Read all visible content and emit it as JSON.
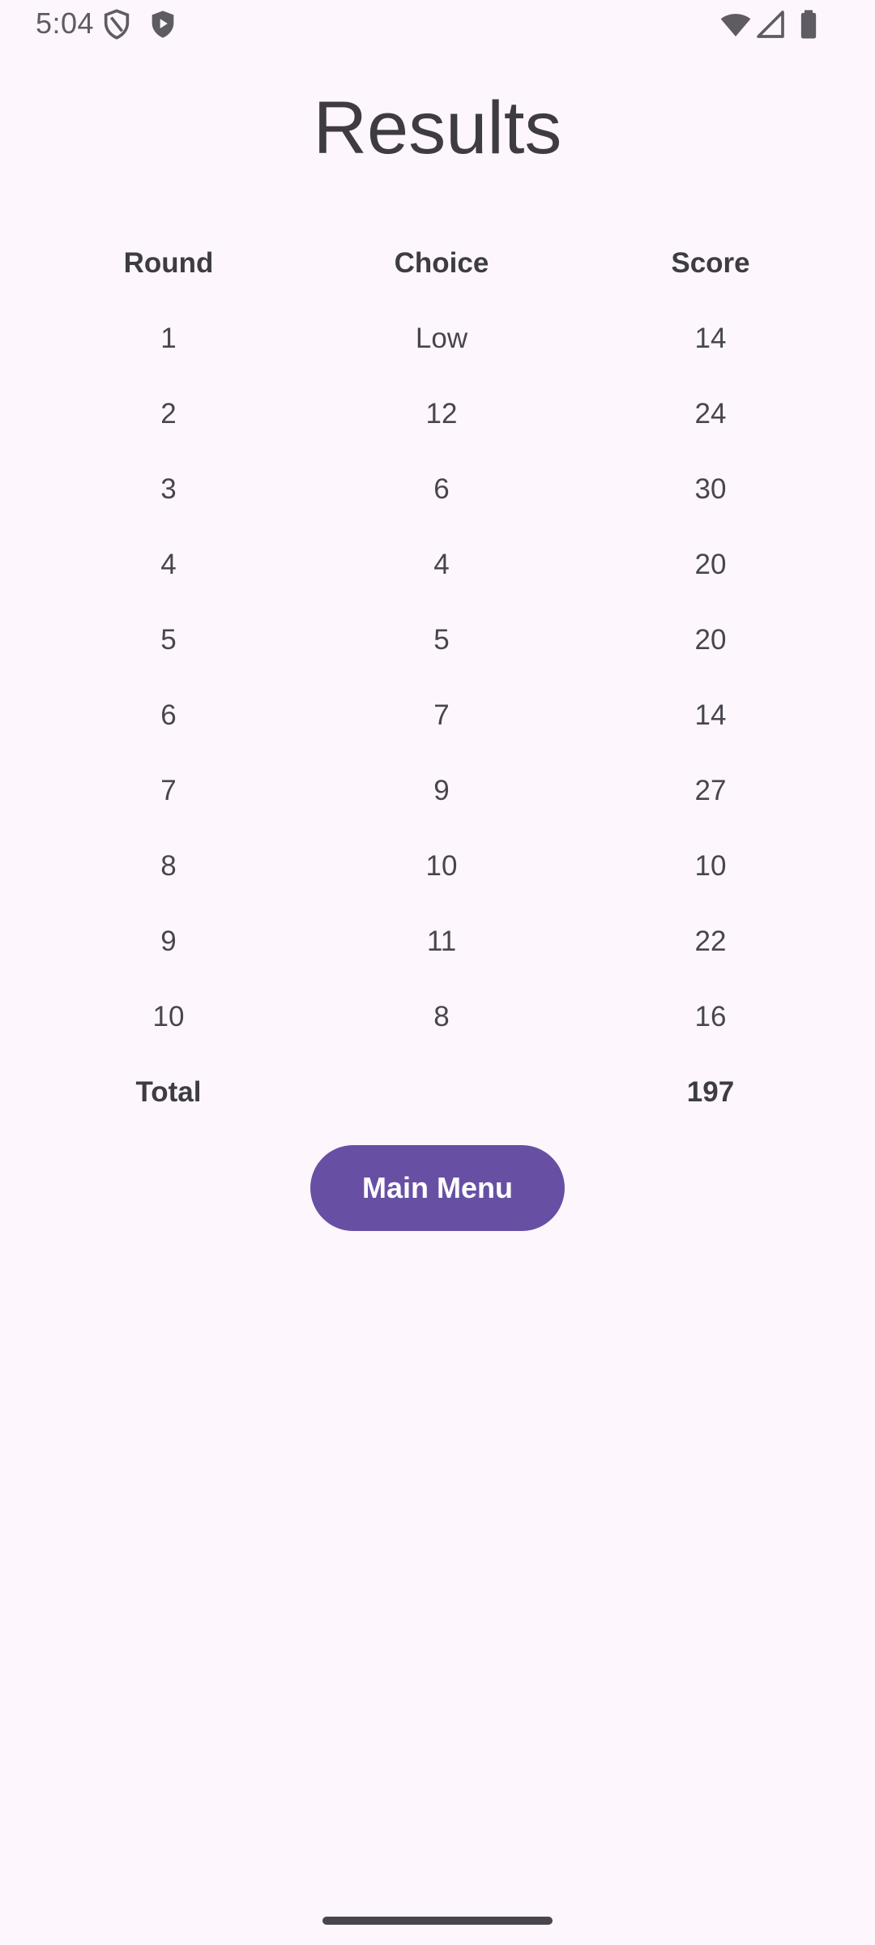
{
  "status_bar": {
    "time": "5:04",
    "icons": [
      "shield-outline-icon",
      "shield-play-icon",
      "wifi-icon",
      "cellular-signal-icon",
      "battery-icon"
    ]
  },
  "title": "Results",
  "table": {
    "headers": [
      "Round",
      "Choice",
      "Score"
    ],
    "rows": [
      [
        "1",
        "Low",
        "14"
      ],
      [
        "2",
        "12",
        "24"
      ],
      [
        "3",
        "6",
        "30"
      ],
      [
        "4",
        "4",
        "20"
      ],
      [
        "5",
        "5",
        "20"
      ],
      [
        "6",
        "7",
        "14"
      ],
      [
        "7",
        "9",
        "27"
      ],
      [
        "8",
        "10",
        "10"
      ],
      [
        "9",
        "11",
        "22"
      ],
      [
        "10",
        "8",
        "16"
      ]
    ],
    "total_label": "Total",
    "total_value": "197"
  },
  "main_menu_label": "Main Menu",
  "colors": {
    "background": "#fdf7fd",
    "button": "#6750a4",
    "text": "#49454f"
  }
}
